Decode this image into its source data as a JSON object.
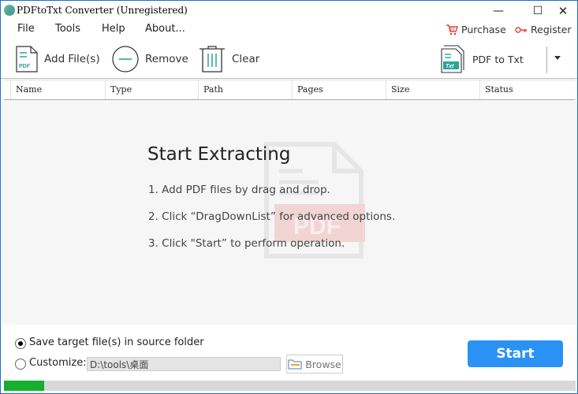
{
  "window": {
    "title": "PDFtoTxt Converter (Unregistered)",
    "controls": {
      "minimize": "—",
      "maximize": "☐",
      "close": "✕"
    }
  },
  "menu": {
    "items": [
      {
        "label": "File"
      },
      {
        "label": "Tools"
      },
      {
        "label": "Help"
      },
      {
        "label": "About..."
      }
    ],
    "purchase_label": "Purchase",
    "register_label": "Register"
  },
  "toolbar": {
    "add_files_label": "Add File(s)",
    "add_files_icon_text": "PDF",
    "remove_label": "Remove",
    "clear_label": "Clear",
    "mode_label": "PDF to Txt",
    "mode_icon_text": "Txt"
  },
  "table": {
    "columns": [
      "Name",
      "Type",
      "Path",
      "Pages",
      "Size",
      "Status"
    ],
    "rows": []
  },
  "instructions": {
    "heading": "Start Extracting",
    "steps": [
      "1. Add PDF files by drag and drop.",
      "2. Click “DragDownList” for advanced options.",
      "3. Click \"Start” to perform operation."
    ],
    "watermark_text": "PDF"
  },
  "output": {
    "option_source_label": "Save target file(s) in source folder",
    "option_source_selected": true,
    "option_custom_label": "Customize:",
    "option_custom_selected": false,
    "custom_path_value": "D:\\tools\\桌面",
    "browse_label": "Browse"
  },
  "start_label": "Start",
  "progress": {
    "percent": 7
  },
  "colors": {
    "accent": "#2b92f5",
    "progress": "#15b030",
    "brand_teal": "#2aa59a",
    "purchase_red": "#e0443c"
  }
}
